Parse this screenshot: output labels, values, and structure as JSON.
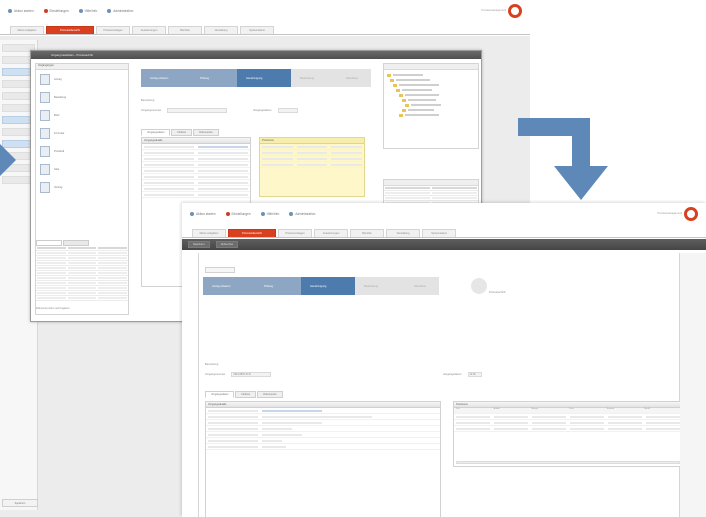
{
  "topbar": {
    "items": [
      "Aktion starten",
      "Einstellungen",
      "Hilfe/Info",
      "Administration"
    ]
  },
  "logo_caption": "Prozessmanagement",
  "nav_tabs": [
    "Meine Aufgaben",
    "Prozessübersicht",
    "Prozessvorlagen",
    "Auswertungen",
    "Berichte",
    "Verwaltung",
    "Systemstatus"
  ],
  "dialog": {
    "title": "Vorgang bearbeiten – Prozessschritt",
    "left_header": "Vorgangstypen",
    "doc_types": [
      "Antrag",
      "Bestellung",
      "Brief",
      "Formular",
      "Protokoll",
      "Akte",
      "Vertrag"
    ],
    "table_tabs": [
      "Zuordnungen",
      "Historie"
    ],
    "status_caption": "Dokument prüfen und freigeben"
  },
  "process_steps": [
    "Antrag erfassen",
    "Prüfung",
    "Genehmigung",
    "Bearbeitung",
    "Abschluss"
  ],
  "front": {
    "toolbar": [
      "Speichern",
      "Abbrechen"
    ],
    "step_caption": "Prozessschritt",
    "form": {
      "label_1": "Bemerkung",
      "label_2": "Vorgangsnummer",
      "value_2": "2014-0815-4711",
      "label_3": "Eingangsdatum",
      "value_3": "12.03."
    },
    "panel_tabs": [
      "Vorgangsdaten",
      "Notizen",
      "Dokumente"
    ],
    "details_header": "Vorgangsdetails",
    "details_rows": [
      [
        "Bezeichnung",
        "Rechnungseingang"
      ],
      [
        "Beschreibung",
        "Eingang Lieferantenrechnung zur Prüfung"
      ],
      [
        "Sachbearbeitung",
        "Buchhaltung"
      ],
      [
        "Kostenstelle",
        "4710"
      ],
      [
        "Betrag",
        "1.250,00 EUR"
      ],
      [
        "Fälligkeit",
        "31.03."
      ],
      [
        "Status",
        "in Bearbeitung"
      ]
    ],
    "positions_header": "Positionen",
    "positions_columns": [
      "Pos",
      "Artikel",
      "Menge",
      "Preis",
      "Summe",
      "MwSt"
    ],
    "positions_rows": 3
  },
  "colors": {
    "brand_red": "#d9401f",
    "step_done": "#8da6c4",
    "step_current": "#4e7bad",
    "flow_arrow": "#5e88b8",
    "toolbar_dark": "#4e4e4e"
  }
}
